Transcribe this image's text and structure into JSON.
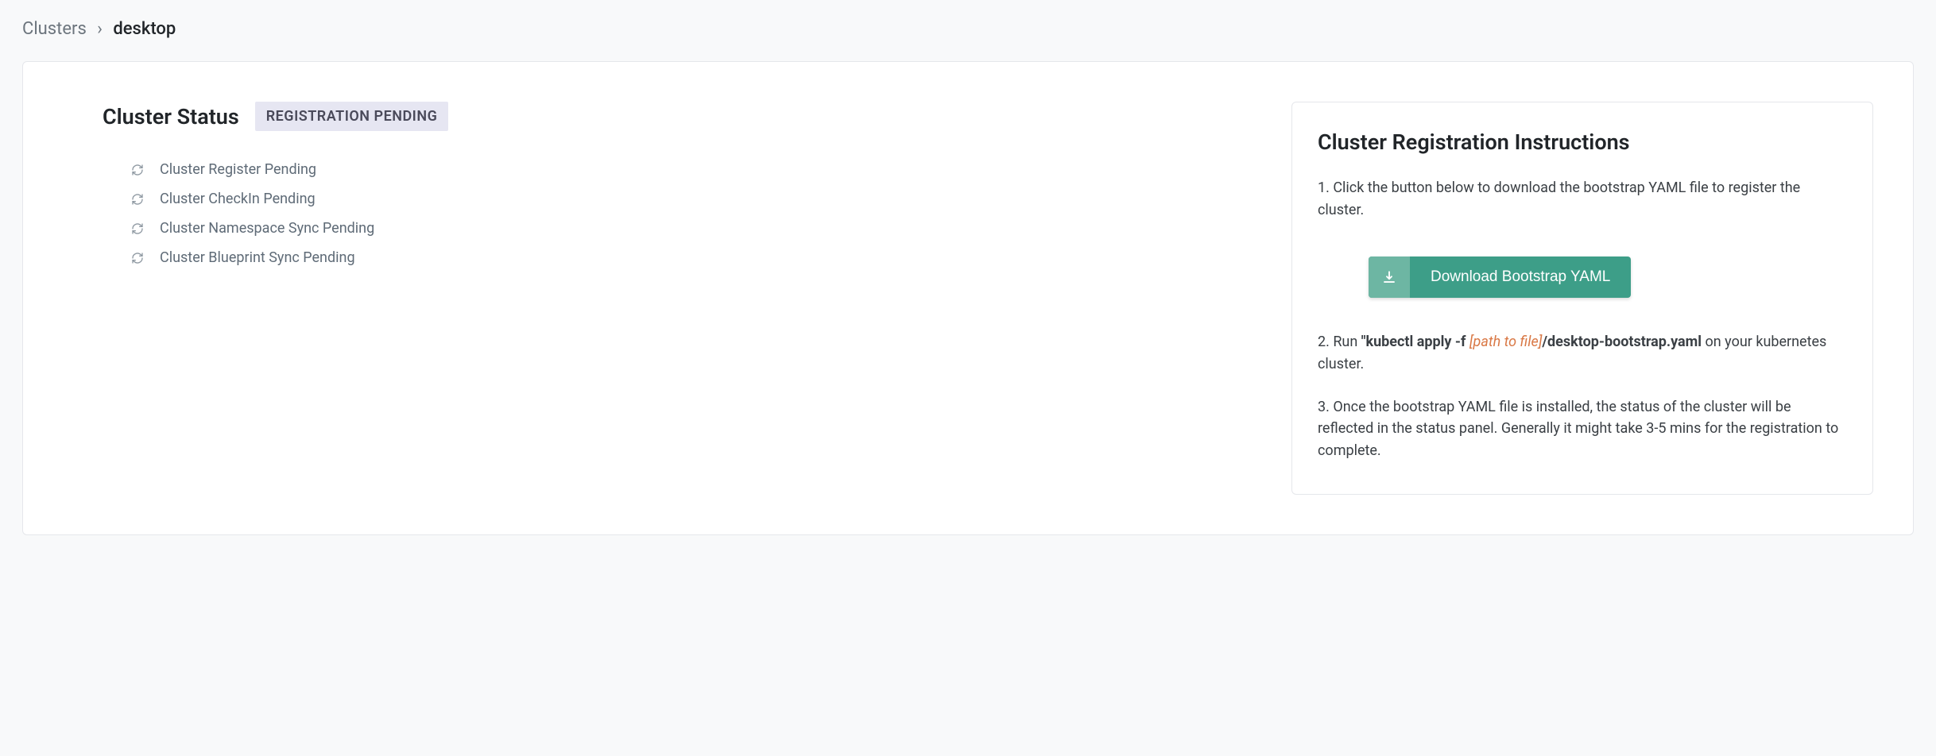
{
  "breadcrumb": {
    "parent": "Clusters",
    "separator": "›",
    "current": "desktop"
  },
  "status": {
    "title": "Cluster Status",
    "badge": "REGISTRATION PENDING",
    "items": [
      "Cluster Register Pending",
      "Cluster CheckIn Pending",
      "Cluster Namespace Sync Pending",
      "Cluster Blueprint Sync Pending"
    ]
  },
  "instructions": {
    "title": "Cluster Registration Instructions",
    "step1": "1. Click the button below to download the bootstrap YAML file to register the cluster.",
    "downloadLabel": "Download Bootstrap YAML",
    "step2_prefix": "2. Run  ",
    "step2_cmd1": "\"kubectl apply -f  ",
    "step2_path": "[path to file]",
    "step2_cmd2": "/desktop-bootstrap.yaml",
    "step2_suffix": "  on your kubernetes cluster.",
    "step3": "3. Once the bootstrap YAML file is installed, the status of the cluster will be reflected in the status panel. Generally it might take 3-5 mins for the registration to complete."
  }
}
